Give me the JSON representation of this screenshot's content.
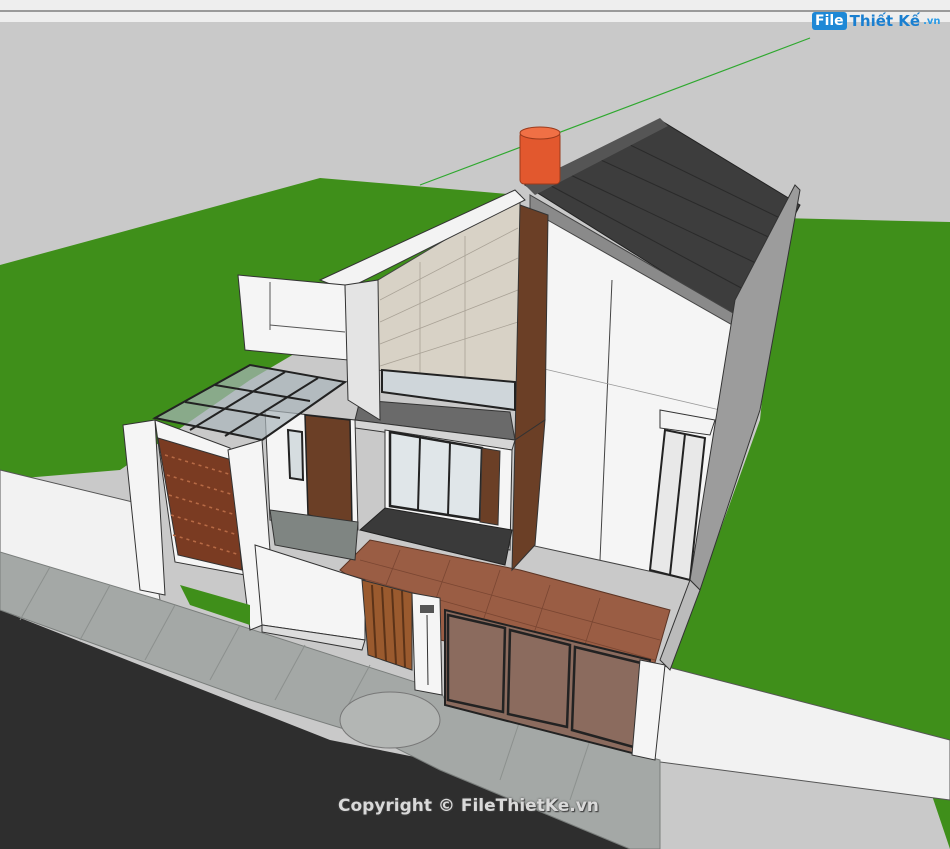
{
  "logo": {
    "badge": "File",
    "name": "Thiết Kế",
    "tld": ".vn"
  },
  "watermark": "Copyright © FileThietKe.vn",
  "colors": {
    "sky": "#c9c9c9",
    "grass": "#3f8f1a",
    "road": "#2e2e2e",
    "sidewalk": "#a4a8a6",
    "roof": "#3d3d3d",
    "wall": "#f3f3f3",
    "tank": "#e2582e",
    "wood": "#6b3f26",
    "brick_paving": "#9a5d44"
  }
}
